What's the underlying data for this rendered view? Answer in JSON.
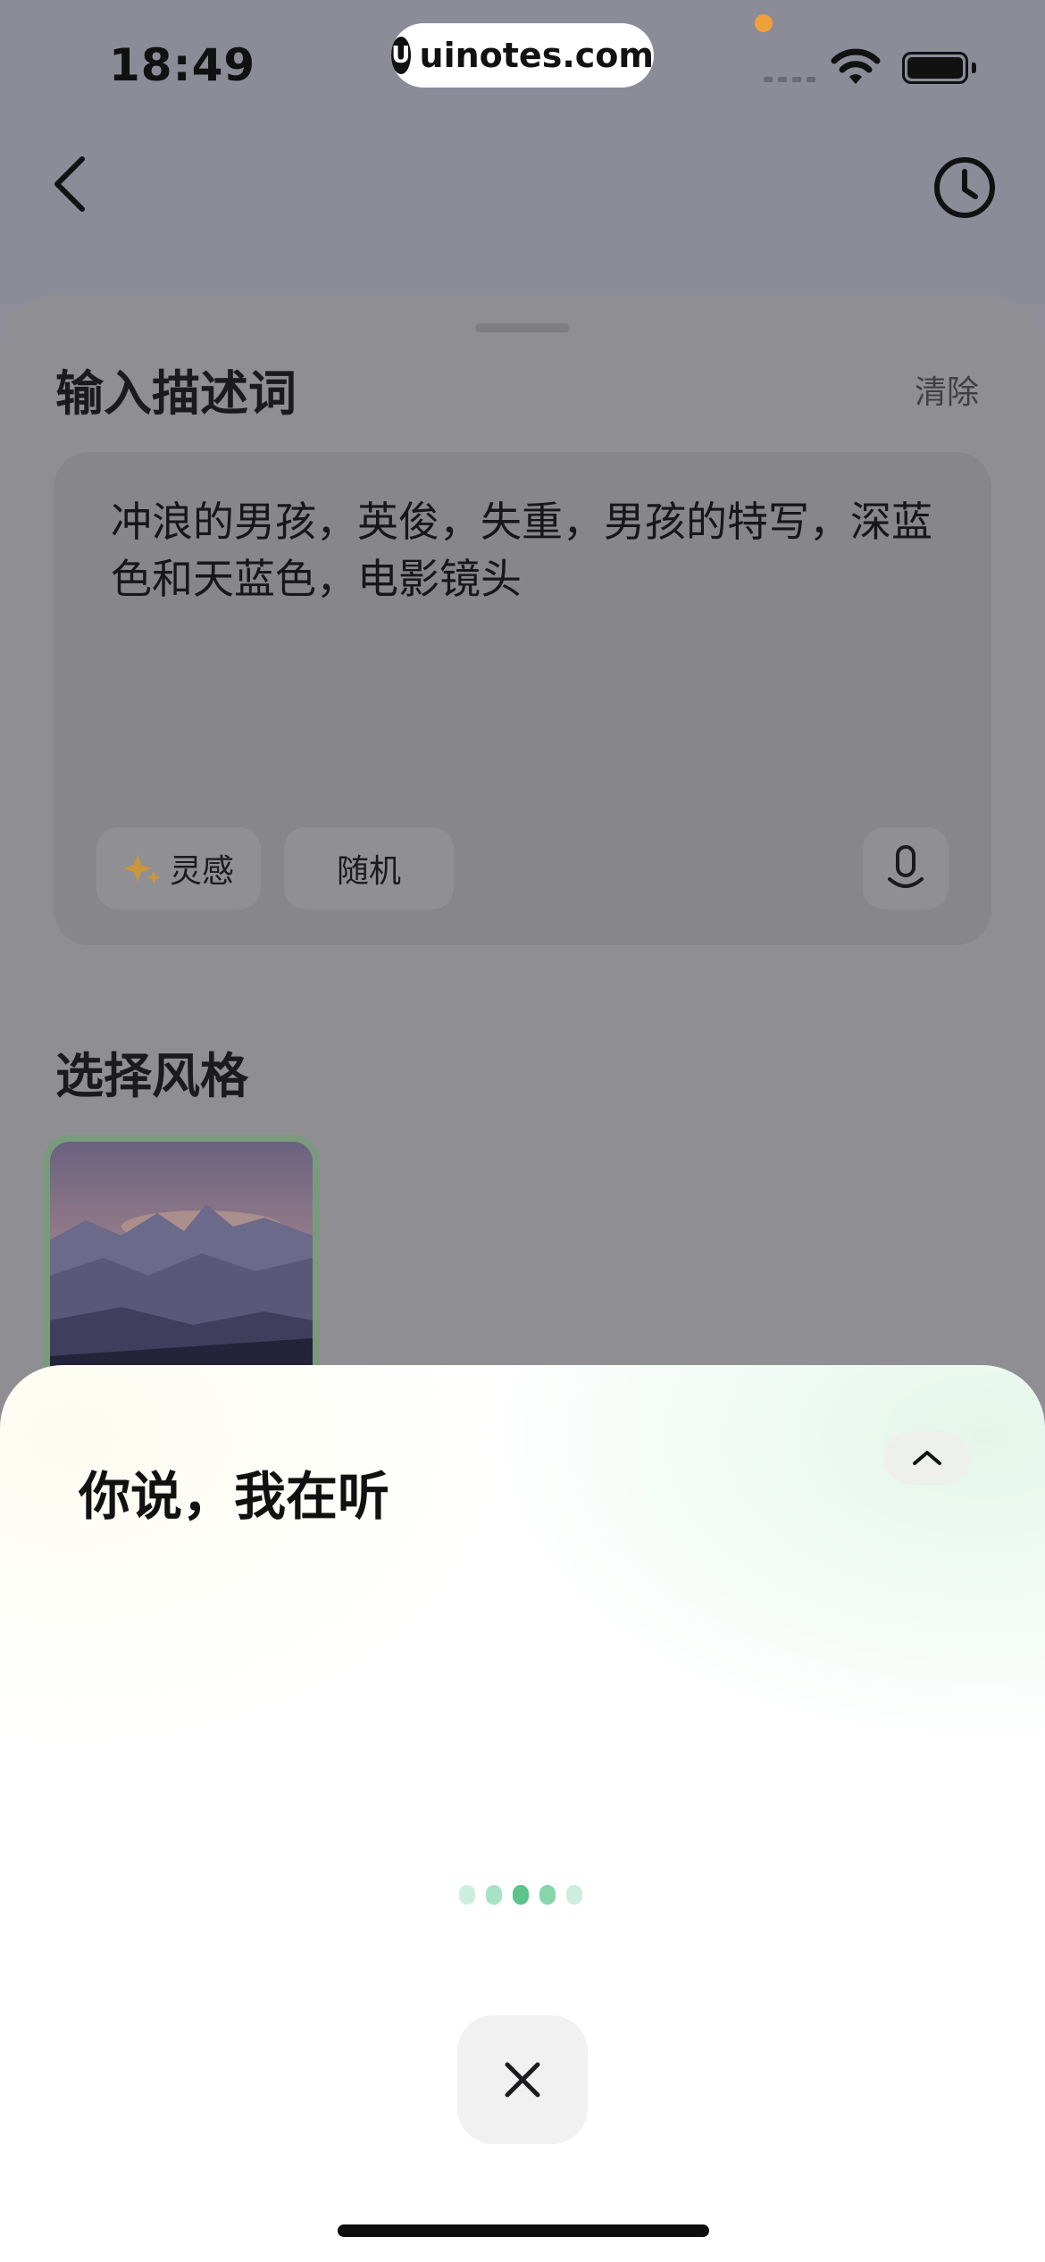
{
  "status_bar": {
    "time": "18:49",
    "watermark": "uinotes.com",
    "watermark_logo": "U"
  },
  "nav": {
    "back_icon": "chevron-left-icon",
    "history_icon": "clock-icon"
  },
  "prompt_section": {
    "title": "输入描述词",
    "clear_label": "清除",
    "text": "冲浪的男孩，英俊，失重，男孩的特写，深蓝色和天蓝色，电影镜头",
    "chips": [
      {
        "label": "灵感",
        "icon": "sparkle-icon"
      },
      {
        "label": "随机"
      }
    ],
    "mic_icon": "microphone-icon"
  },
  "style_section": {
    "title": "选择风格",
    "selected_style_image": "mountain-dusk-landscape"
  },
  "voice_panel": {
    "title": "你说，我在听",
    "collapse_icon": "chevron-up-icon",
    "close_icon": "close-icon",
    "dot_colors": [
      "#cdeedd",
      "#a6e2c3",
      "#5cc38a",
      "#86d5ab",
      "#cdeedd"
    ]
  },
  "colors": {
    "accent_green": "#5cc38a",
    "sparkle_gold": "#d7a03b"
  }
}
